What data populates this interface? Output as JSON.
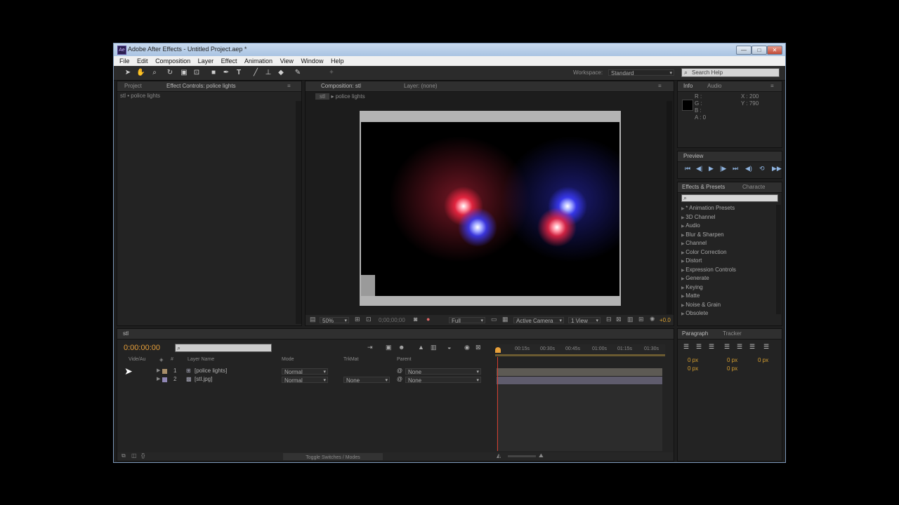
{
  "window": {
    "title": "Adobe After Effects - Untitled Project.aep *",
    "controls": [
      "—",
      "□",
      "✕"
    ]
  },
  "menu": [
    "File",
    "Edit",
    "Composition",
    "Layer",
    "Effect",
    "Animation",
    "View",
    "Window",
    "Help"
  ],
  "toolbar": {
    "tools": [
      "selection-tool-icon",
      "hand-tool-icon",
      "zoom-tool-icon",
      "rotate-tool-icon",
      "camera-tool-icon",
      "pan-behind-tool-icon",
      "rectangle-tool-icon",
      "pen-tool-icon",
      "type-tool-icon",
      "brush-tool-icon",
      "clone-stamp-tool-icon",
      "eraser-tool-icon",
      "roto-brush-tool-icon",
      "puppet-tool-icon"
    ],
    "workspace_label": "Workspace:",
    "workspace_value": "Standard",
    "search_placeholder": "Search Help"
  },
  "project_panel": {
    "tabs": [
      "Project",
      "Effect Controls: police lights"
    ],
    "subtitle": "stl • police lights"
  },
  "composition_panel": {
    "tabs": [
      "Composition: stl",
      "Layer: (none)"
    ],
    "breadcrumb": [
      "stl",
      "police lights"
    ],
    "zoom": "50%",
    "timecode_readout": "0;00;00;00",
    "resolution": "Full",
    "camera": "Active Camera",
    "view": "1 View",
    "exposure": "+0.0"
  },
  "info_panel": {
    "tabs": [
      "Info",
      "Audio"
    ],
    "r": "R :",
    "g": "G :",
    "b": "B :",
    "a": "A : 0",
    "x": "X : 200",
    "y": "Y : 790"
  },
  "preview_panel": {
    "title": "Preview"
  },
  "effects_panel": {
    "tabs": [
      "Effects & Presets",
      "Characte"
    ],
    "categories": [
      "* Animation Presets",
      "3D Channel",
      "Audio",
      "Blur & Sharpen",
      "Channel",
      "Color Correction",
      "Distort",
      "Expression Controls",
      "Generate",
      "Keying",
      "Matte",
      "Noise & Grain",
      "Obsolete"
    ]
  },
  "paragraph_panel": {
    "tabs": [
      "Paragraph",
      "Tracker"
    ],
    "fields": [
      "0 px",
      "0 px",
      "0 px",
      "0 px",
      "0 px"
    ]
  },
  "timeline": {
    "tab": "stl",
    "timecode": "0:00:00:00",
    "column_headers": [
      "Vide/Au",
      "#",
      "Layer Name",
      "Mode",
      "TrkMat",
      "Parent"
    ],
    "layers": [
      {
        "index": "1",
        "name": "[police lights]",
        "mode": "Normal",
        "trkmat": "",
        "parent": "None"
      },
      {
        "index": "2",
        "name": "[stl.jpg]",
        "mode": "Normal",
        "trkmat": "None",
        "parent": "None"
      }
    ],
    "ruler": [
      "00:15s",
      "00:30s",
      "00:45s",
      "01:00s",
      "01:15s",
      "01:30s"
    ],
    "toggle_label": "Toggle Switches / Modes"
  },
  "colors": {
    "accent": "#e8a03a",
    "red_light": "#ff3355",
    "blue_light": "#4455ff",
    "label_tan": "#a88e6a",
    "label_purple": "#8f86b4"
  }
}
